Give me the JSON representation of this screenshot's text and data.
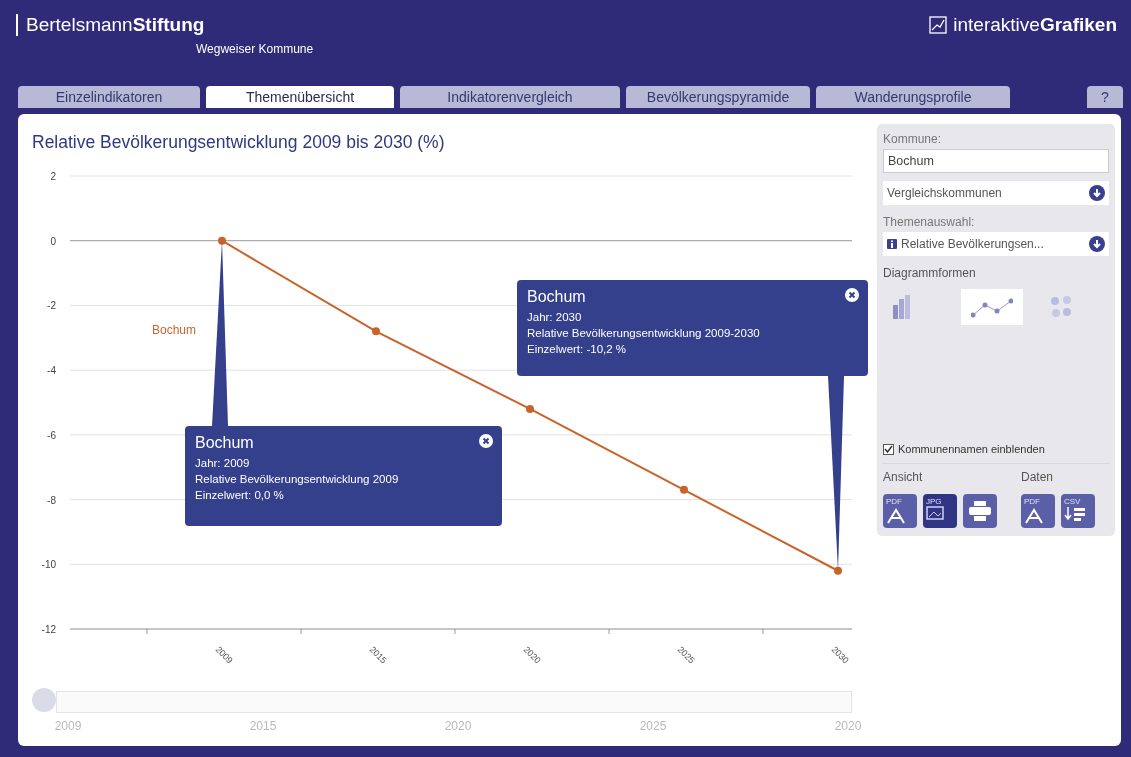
{
  "header": {
    "brand_light": "Bertelsmann",
    "brand_bold": "Stiftung",
    "subtitle": "Wegweiser Kommune",
    "product_light": "interaktive",
    "product_bold": "Grafiken"
  },
  "tabs": [
    {
      "label": "Einzelindikatoren",
      "selected": false
    },
    {
      "label": "Themenübersicht",
      "selected": true
    },
    {
      "label": "Indikatorenvergleich",
      "selected": false
    },
    {
      "label": "Bevölkerungspyramide",
      "selected": false
    },
    {
      "label": "Wanderungsprofile",
      "selected": false
    }
  ],
  "help_tab": {
    "label": "?"
  },
  "chart": {
    "title": "Relative Bevölkerungsentwicklung 2009 bis 2030 (%)",
    "chart_data": {
      "type": "line",
      "categories": [
        "2009",
        "2015",
        "2020",
        "2025",
        "2030"
      ],
      "ylim": [
        -12,
        2
      ],
      "yticks": [
        2,
        0,
        -2,
        -4,
        -6,
        -8,
        -10,
        -12
      ],
      "grid": true,
      "series": [
        {
          "name": "Bochum",
          "color": "#c8642a",
          "marker": "circle",
          "values": [
            0,
            -2.8,
            -5.2,
            -7.7,
            -10.2
          ]
        }
      ]
    },
    "tooltips": [
      {
        "title": "Bochum",
        "lines": [
          "Jahr: 2009",
          "Relative Bevölkerungsentwicklung 2009",
          "Einzelwert: 0,0 %"
        ]
      },
      {
        "title": "Bochum",
        "lines": [
          "Jahr: 2030",
          "Relative Bevölkerungsentwicklung 2009-2030",
          "Einzelwert: -10,2 %"
        ]
      }
    ]
  },
  "timeline": {
    "level": 0,
    "labels": [
      "2009",
      "2015",
      "2020",
      "2025",
      "2020"
    ]
  },
  "sidebar": {
    "kommune_label": "Kommune:",
    "kommune_value": "Bochum",
    "vergleich": "Vergleichskommunen",
    "themen_label": "Themenauswahl:",
    "themen_value": "Relative Bevölkerungsen...",
    "diagram_label": "Diagrammformen",
    "diagram_types": [
      {
        "kind": "bar",
        "selected": false
      },
      {
        "kind": "line",
        "selected": true
      },
      {
        "kind": "bubble",
        "selected": false
      }
    ],
    "show_names": {
      "label": "Kommunennamen einblenden",
      "checked": true
    },
    "ansicht_label": "Ansicht",
    "daten_label": "Daten",
    "ansicht_buttons": [
      {
        "kind": "pdf",
        "label": "PDF",
        "selected": false
      },
      {
        "kind": "jpg",
        "label": "JPG",
        "selected": true
      },
      {
        "kind": "print",
        "selected": false
      }
    ],
    "daten_buttons": [
      {
        "kind": "pdf",
        "label": "PDF",
        "selected": false
      },
      {
        "kind": "csv",
        "label": "CSV",
        "selected": false
      }
    ]
  }
}
